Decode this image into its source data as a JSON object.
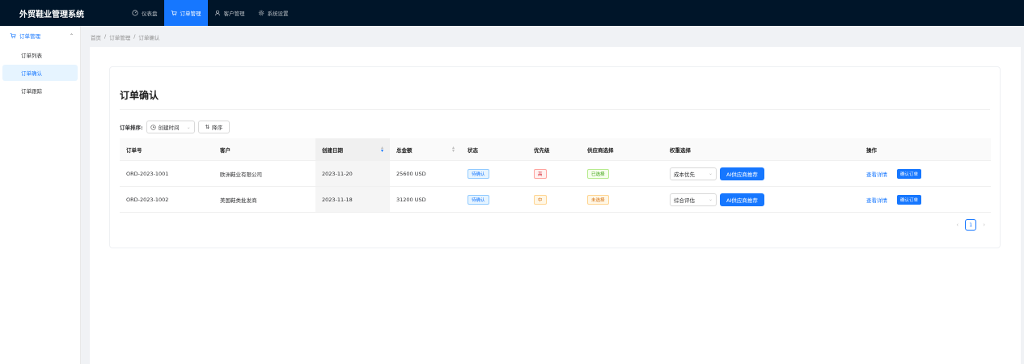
{
  "app": {
    "title": "外贸鞋业管理系统"
  },
  "topnav": [
    {
      "label": "仪表盘",
      "icon": "dashboard-icon"
    },
    {
      "label": "订单管理",
      "icon": "cart-icon",
      "active": true
    },
    {
      "label": "客户管理",
      "icon": "user-icon"
    },
    {
      "label": "系统设置",
      "icon": "gear-icon"
    }
  ],
  "sidebar": {
    "group_label": "订单管理",
    "items": [
      {
        "label": "订单列表"
      },
      {
        "label": "订单确认",
        "active": true
      },
      {
        "label": "订单跟踪"
      }
    ]
  },
  "breadcrumb": [
    "首页",
    "订单管理",
    "订单确认"
  ],
  "page": {
    "title": "订单确认"
  },
  "sort": {
    "label": "订单排序:",
    "field": "创建时间",
    "order_button": "降序"
  },
  "table": {
    "columns": [
      "订单号",
      "客户",
      "创建日期",
      "总金额",
      "状态",
      "优先级",
      "供应商选择",
      "权重选择",
      "操作"
    ],
    "rows": [
      {
        "order_id": "ORD-2023-1001",
        "customer": "欧洲鞋业有限公司",
        "date": "2023-11-20",
        "amount": "25600 USD",
        "status": "待确认",
        "priority": "高",
        "priority_color": "#cf1322",
        "supplier": "已选择",
        "supplier_color": "#389e0d",
        "weight": "成本优先",
        "ai_button": "AI供应商推荐",
        "detail_link": "查看详情",
        "confirm_button": "确认订单"
      },
      {
        "order_id": "ORD-2023-1002",
        "customer": "美国鞋类批发商",
        "date": "2023-11-18",
        "amount": "31200 USD",
        "status": "待确认",
        "priority": "中",
        "priority_color": "#d46b08",
        "supplier": "未选择",
        "supplier_color": "#d46b08",
        "weight": "综合评估",
        "ai_button": "AI供应商推荐",
        "detail_link": "查看详情",
        "confirm_button": "确认订单"
      }
    ]
  },
  "pagination": {
    "current": "1"
  },
  "colors": {
    "accent": "#1677ff",
    "header_bg": "#001529"
  }
}
